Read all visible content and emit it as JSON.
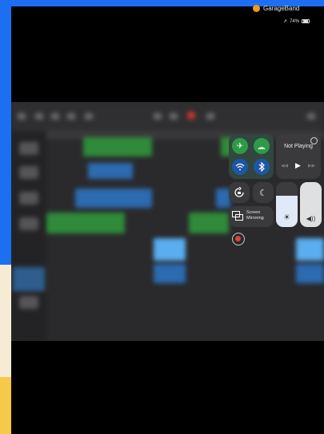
{
  "status_bar": {
    "app_name": "GarageBand",
    "battery": "74%",
    "app_icon_color": "#f29a1d"
  },
  "control_center": {
    "connectivity": {
      "airplane_mode": "airplane-icon",
      "cellular": "antenna-icon",
      "wifi": "wifi-icon",
      "bluetooth": "bluetooth-icon"
    },
    "music": {
      "title": "Not Playing",
      "airplay_icon": "airplay-icon",
      "prev_icon": "rewind-icon",
      "play_icon": "play-icon",
      "next_icon": "forward-icon"
    },
    "rotation_lock_icon": "rotation-lock-icon",
    "do_not_disturb_icon": "moon-icon",
    "screen_mirroring": {
      "label": "Screen Mirroring"
    },
    "brightness": {
      "level": 0.7,
      "icon": "sun-icon"
    },
    "volume": {
      "level": 1.0,
      "icon": "speaker-icon"
    },
    "screen_record_icon": "record-icon"
  },
  "colors": {
    "accent_blue": "#1d6ff2",
    "green_region": "#2f8a3a",
    "blue_region": "#2c6bb0"
  }
}
